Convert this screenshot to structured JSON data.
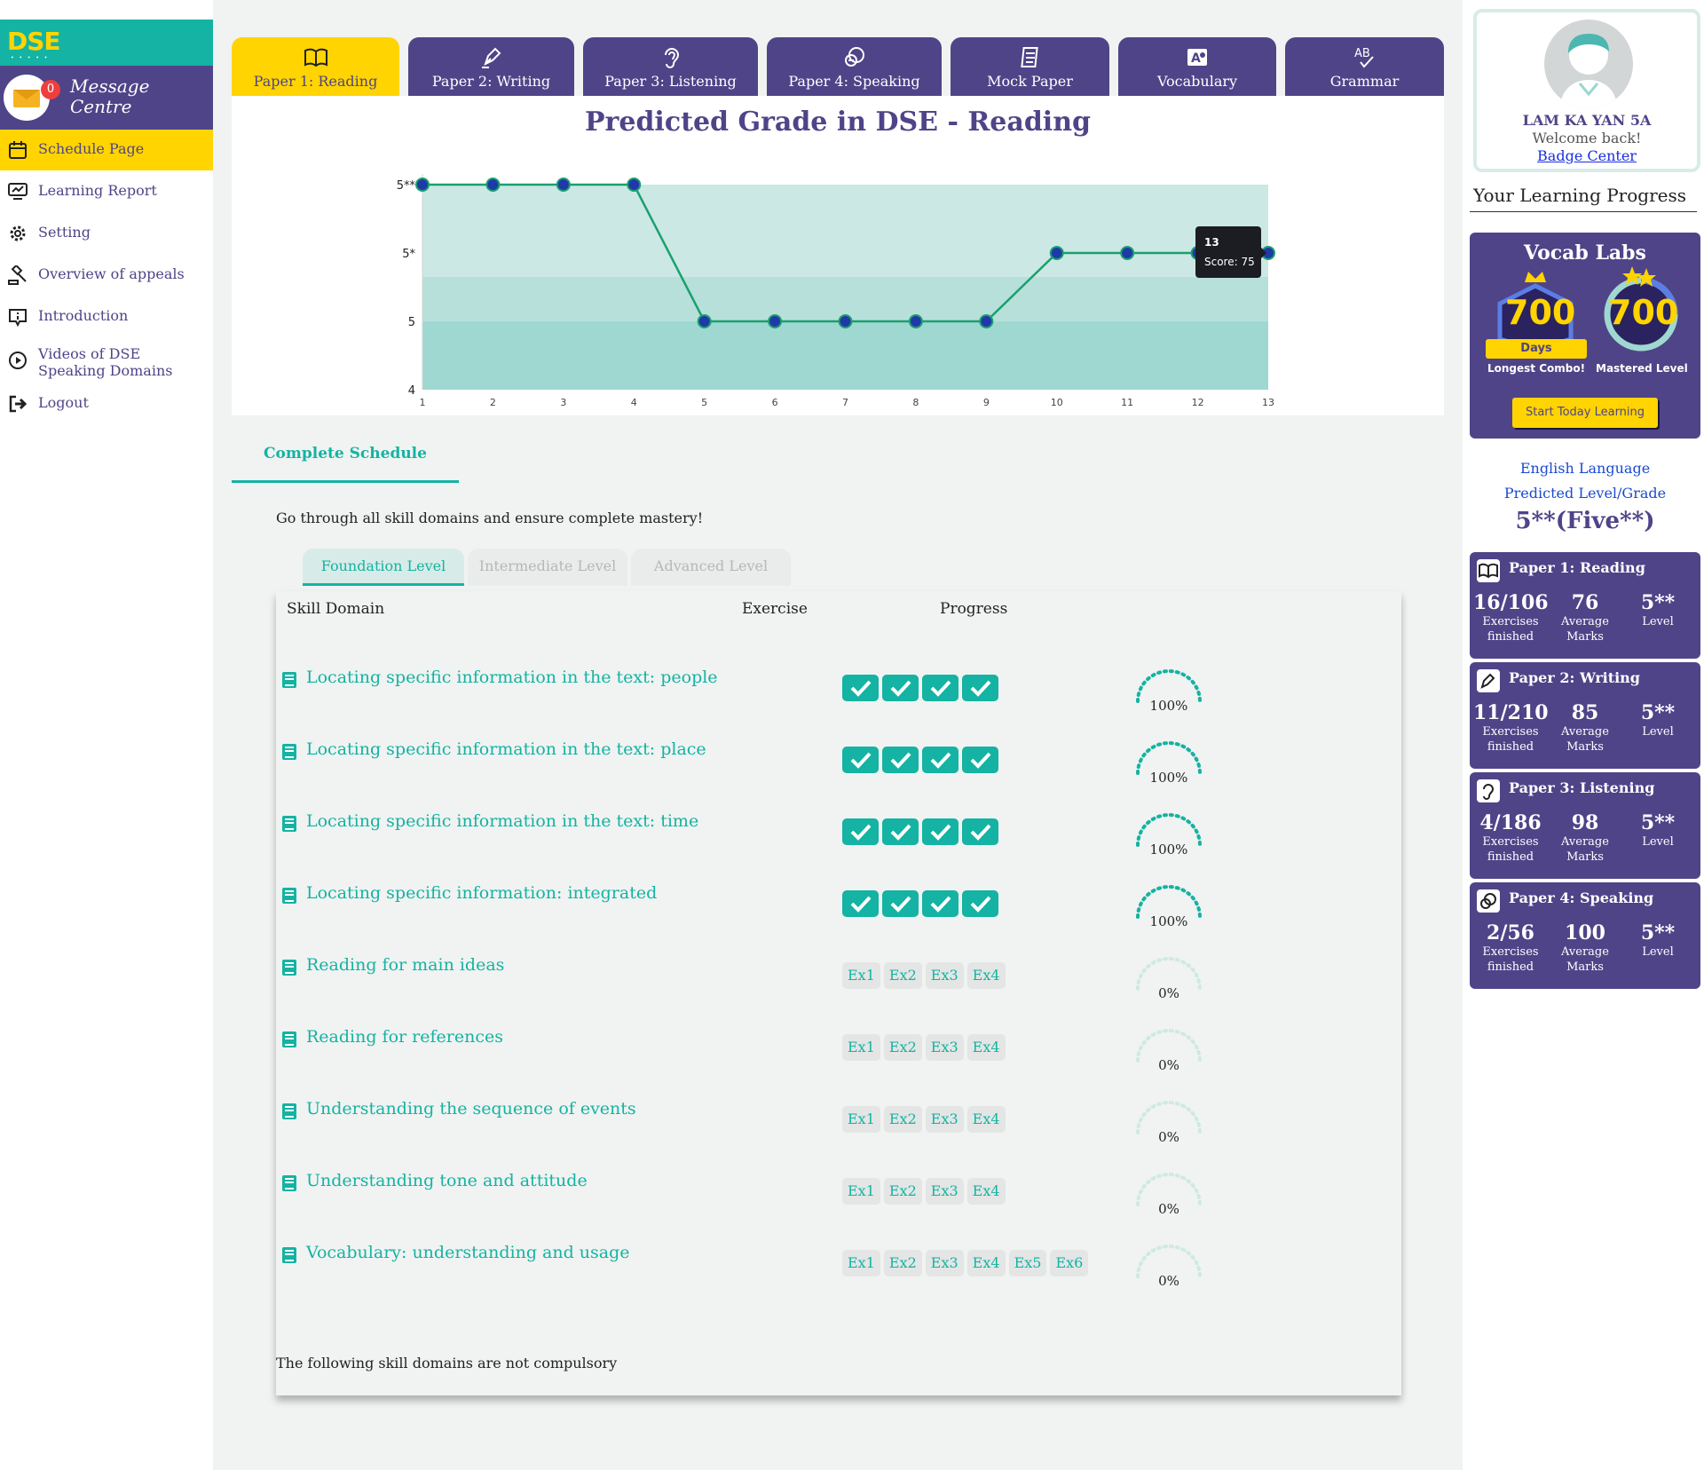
{
  "sidebar": {
    "logo": "DSE",
    "logo_dots": "• • • • •",
    "message_badge": "0",
    "message_label": "Message Centre",
    "items": [
      {
        "label": "Schedule Page",
        "icon": "calendar-icon",
        "active": true
      },
      {
        "label": "Learning Report",
        "icon": "report-icon"
      },
      {
        "label": "Setting",
        "icon": "gear-icon"
      },
      {
        "label": "Overview of appeals",
        "icon": "gavel-icon"
      },
      {
        "label": "Introduction",
        "icon": "info-icon"
      },
      {
        "label": "Videos of DSE Speaking Domains",
        "icon": "play-icon"
      },
      {
        "label": "Logout",
        "icon": "logout-icon"
      }
    ]
  },
  "tabs": [
    {
      "label": "Paper 1: Reading",
      "icon": "book-icon",
      "active": true
    },
    {
      "label": "Paper 2: Writing",
      "icon": "pen-icon"
    },
    {
      "label": "Paper 3: Listening",
      "icon": "ear-icon"
    },
    {
      "label": "Paper 4: Speaking",
      "icon": "speech-icon"
    },
    {
      "label": "Mock Paper",
      "icon": "paper-icon"
    },
    {
      "label": "Vocabulary",
      "icon": "vocabulary-icon"
    },
    {
      "label": "Grammar",
      "icon": "grammar-icon"
    }
  ],
  "chart_data": {
    "type": "line",
    "title": "Predicted Grade in DSE - Reading",
    "x": [
      1,
      2,
      3,
      4,
      5,
      6,
      7,
      8,
      9,
      10,
      11,
      12,
      13
    ],
    "y_levels": [
      "4",
      "5",
      "5*",
      "5**"
    ],
    "series": [
      {
        "values": [
          "5**",
          "5**",
          "5**",
          "5**",
          "5",
          "5",
          "5",
          "5",
          "5",
          "5*",
          "5*",
          "5*",
          "5*"
        ]
      }
    ],
    "tooltip": {
      "title": "13",
      "text": "Score: 75"
    },
    "grid": false,
    "colors": {
      "line": "#1aa06e",
      "point_fill": "#1f3aa8",
      "band_top": "#cbe8e4",
      "band_mid": "#b7e0da",
      "band_low": "#9fd8d0"
    }
  },
  "schedule": {
    "tab_label": "Complete Schedule",
    "intro": "Go through all skill domains and ensure complete mastery!",
    "levels": [
      "Foundation Level",
      "Intermediate Level",
      "Advanced Level"
    ],
    "headers": {
      "skill": "Skill Domain",
      "exercise": "Exercise",
      "progress": "Progress"
    },
    "rows": [
      {
        "name": "Locating specific information in the text: people",
        "exercises": [
          "done",
          "done",
          "done",
          "done"
        ],
        "progress": "100%"
      },
      {
        "name": "Locating specific information in the text: place",
        "exercises": [
          "done",
          "done",
          "done",
          "done"
        ],
        "progress": "100%"
      },
      {
        "name": "Locating specific information in the text: time",
        "exercises": [
          "done",
          "done",
          "done",
          "done"
        ],
        "progress": "100%"
      },
      {
        "name": "Locating specific information: integrated",
        "exercises": [
          "done",
          "done",
          "done",
          "done"
        ],
        "progress": "100%"
      },
      {
        "name": "Reading for main ideas",
        "exercises": [
          "Ex1",
          "Ex2",
          "Ex3",
          "Ex4"
        ],
        "progress": "0%"
      },
      {
        "name": "Reading for references",
        "exercises": [
          "Ex1",
          "Ex2",
          "Ex3",
          "Ex4"
        ],
        "progress": "0%"
      },
      {
        "name": "Understanding the sequence of events",
        "exercises": [
          "Ex1",
          "Ex2",
          "Ex3",
          "Ex4"
        ],
        "progress": "0%"
      },
      {
        "name": "Understanding tone and attitude",
        "exercises": [
          "Ex1",
          "Ex2",
          "Ex3",
          "Ex4"
        ],
        "progress": "0%"
      },
      {
        "name": "Vocabulary: understanding and usage",
        "exercises": [
          "Ex1",
          "Ex2",
          "Ex3",
          "Ex4",
          "Ex5",
          "Ex6"
        ],
        "progress": "0%"
      }
    ],
    "footer": "The following skill domains are not compulsory"
  },
  "profile": {
    "name": "LAM KA YAN 5A",
    "welcome": "Welcome back!",
    "badge_link": "Badge Center"
  },
  "progress_title": "Your Learning Progress",
  "vocab": {
    "title": "Vocab Labs",
    "combo_value": "700",
    "combo_unit": "Days",
    "combo_caption": "Longest Combo!",
    "mastered_value": "700",
    "mastered_caption": "Mastered Level",
    "start_button": "Start Today Learning"
  },
  "language": {
    "line1": "English Language",
    "line2": "Predicted Level/Grade",
    "grade": "5**(Five**)"
  },
  "papers": [
    {
      "title": "Paper 1: Reading",
      "icon": "book-icon",
      "finished": "16/106",
      "marks": "76",
      "level": "5**"
    },
    {
      "title": "Paper 2: Writing",
      "icon": "pen-icon",
      "finished": "11/210",
      "marks": "85",
      "level": "5**"
    },
    {
      "title": "Paper 3: Listening",
      "icon": "ear-icon",
      "finished": "4/186",
      "marks": "98",
      "level": "5**"
    },
    {
      "title": "Paper 4: Speaking",
      "icon": "speech-icon",
      "finished": "2/56",
      "marks": "100",
      "level": "5**"
    }
  ],
  "paper_captions": {
    "finished": "Exercises finished",
    "marks": "Average Marks",
    "level": "Level"
  },
  "colors": {
    "brand_purple": "#4f4488",
    "accent_teal": "#14b3a3",
    "accent_yellow": "#ffd400"
  }
}
